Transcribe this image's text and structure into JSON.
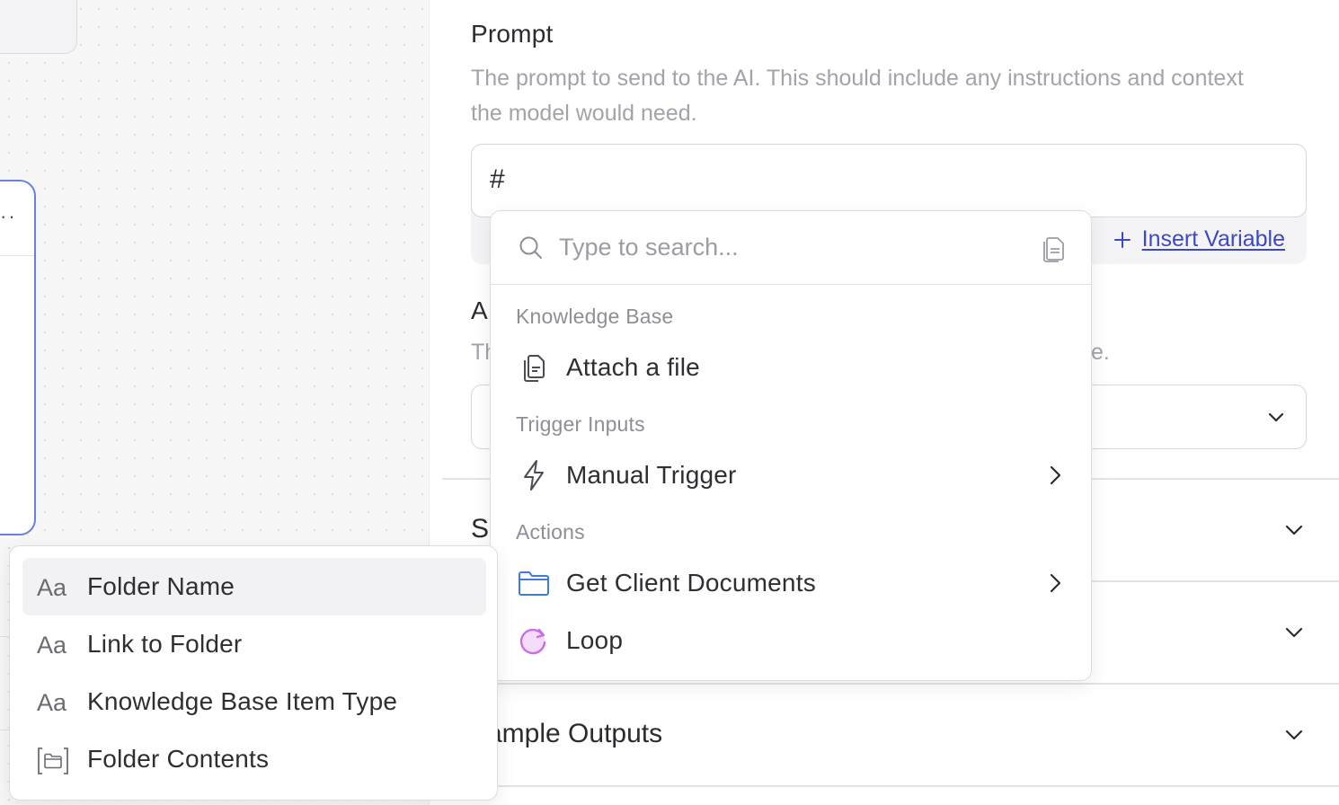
{
  "prompt_field": {
    "label": "Prompt",
    "description": "The prompt to send to the AI. This should include any instructions and context the model would need.",
    "value": "#",
    "insert_variable_label": "Insert Variable"
  },
  "second_field": {
    "label_visible": "A",
    "desc_visible_start": "Th",
    "desc_visible_end": "e."
  },
  "accordions": {
    "first_visible": "S",
    "sample_outputs_visible": "ample Outputs"
  },
  "search_dropdown": {
    "placeholder": "Type to search...",
    "groups": [
      {
        "title": "Knowledge Base",
        "items": [
          {
            "label": "Attach a file",
            "icon": "file-icon",
            "has_submenu": false
          }
        ]
      },
      {
        "title": "Trigger Inputs",
        "items": [
          {
            "label": "Manual Trigger",
            "icon": "lightning-icon",
            "has_submenu": true
          }
        ]
      },
      {
        "title": "Actions",
        "items": [
          {
            "label": "Get Client Documents",
            "icon": "folder-icon",
            "has_submenu": true
          },
          {
            "label": "Loop",
            "icon": "loop-icon",
            "has_submenu": false
          }
        ]
      }
    ]
  },
  "variable_submenu": {
    "items": [
      {
        "label": "Folder Name",
        "icon": "text-type-icon",
        "glyph": "Aa",
        "active": true
      },
      {
        "label": "Link to Folder",
        "icon": "text-type-icon",
        "glyph": "Aa",
        "active": false
      },
      {
        "label": "Knowledge Base Item Type",
        "icon": "text-type-icon",
        "glyph": "Aa",
        "active": false
      },
      {
        "label": "Folder Contents",
        "icon": "folder-list-icon",
        "glyph": "",
        "active": false
      }
    ]
  },
  "colors": {
    "link": "#3b49c8",
    "selected_node_border": "#6b7fe0",
    "folder_icon": "#3d7be0",
    "loop_icon": "#c86ee8"
  }
}
